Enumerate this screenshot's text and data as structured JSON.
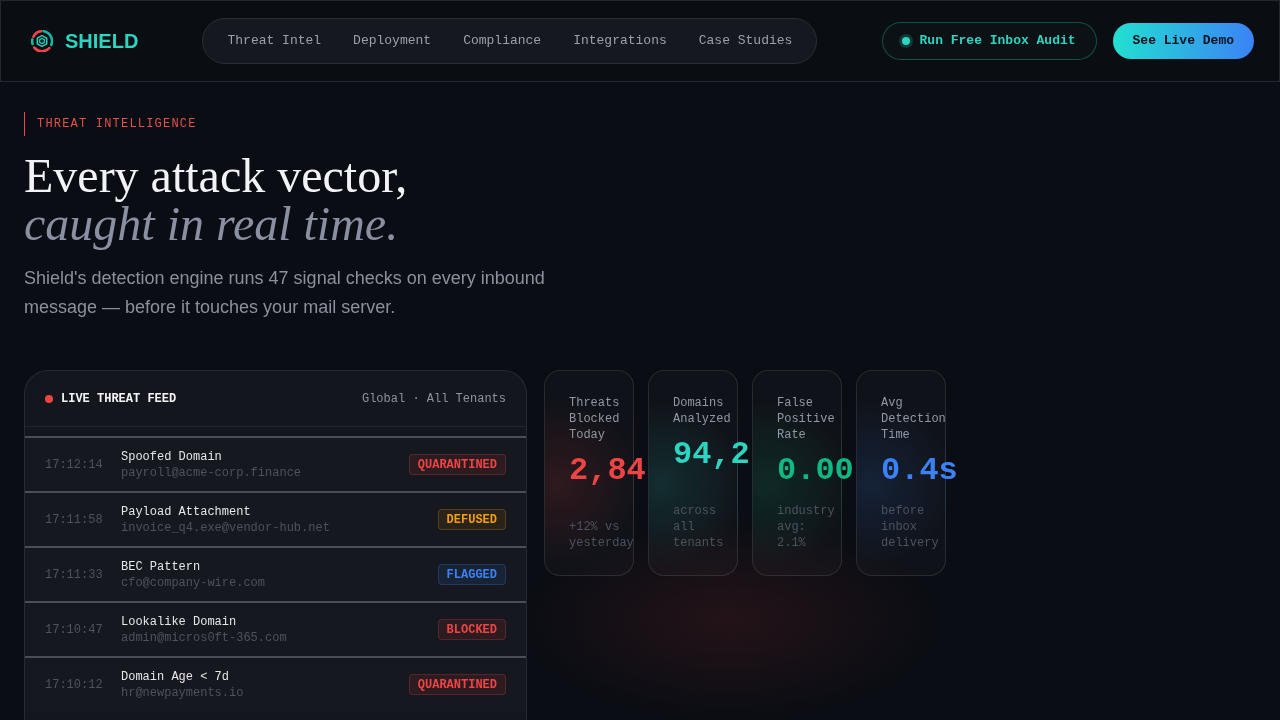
{
  "nav": {
    "brand": "SHIELD",
    "links": [
      "Threat Intel",
      "Deployment",
      "Compliance",
      "Integrations",
      "Case Studies"
    ],
    "actions": [
      {
        "label": "Run Free Inbox Audit",
        "kind": "outline"
      },
      {
        "label": "See Live Demo",
        "kind": "gradient"
      }
    ]
  },
  "hero": {
    "eyebrow": "THREAT INTELLIGENCE",
    "title": "Every attack vector,",
    "title_emphasis": "caught in real time.",
    "description": "Shield's detection engine runs 47 signal checks on every inbound message — before it touches your mail server."
  },
  "feed": {
    "title": "LIVE THREAT FEED",
    "scope": "Global · All Tenants",
    "rows": [
      {
        "time": "17:12:14",
        "threat": "Spoofed Domain",
        "sender": "payroll@acme-corp.finance",
        "status": {
          "label": "QUARANTINED",
          "kind": "danger"
        }
      },
      {
        "time": "17:11:58",
        "threat": "Payload Attachment",
        "sender": "invoice_q4.exe@vendor-hub.net",
        "status": {
          "label": "DEFUSED",
          "kind": "warning"
        }
      },
      {
        "time": "17:11:33",
        "threat": "BEC Pattern",
        "sender": "cfo@company-wire.com",
        "status": {
          "label": "FLAGGED",
          "kind": "info"
        }
      },
      {
        "time": "17:10:47",
        "threat": "Lookalike Domain",
        "sender": "admin@micros0ft-365.com",
        "status": {
          "label": "BLOCKED",
          "kind": "danger"
        }
      },
      {
        "time": "17:10:12",
        "threat": "Domain Age < 7d",
        "sender": "hr@newpayments.io",
        "status": {
          "label": "QUARANTINED",
          "kind": "danger"
        }
      }
    ]
  },
  "stats": [
    {
      "label": "Threats Blocked Today",
      "value": "2,84",
      "note": "+12% vs yesterday",
      "color": "#ef4444"
    },
    {
      "label": "Domains Analyzed",
      "value": "94,2",
      "note": "across all tenants",
      "color": "#2dd4bf"
    },
    {
      "label": "False Positive Rate",
      "value": "0.00",
      "note": "industry avg: 2.1%",
      "color": "#10b981"
    },
    {
      "label": "Avg Detection Time",
      "value": "0.4s",
      "note": "before inbox delivery",
      "color": "#3b82f6"
    }
  ]
}
